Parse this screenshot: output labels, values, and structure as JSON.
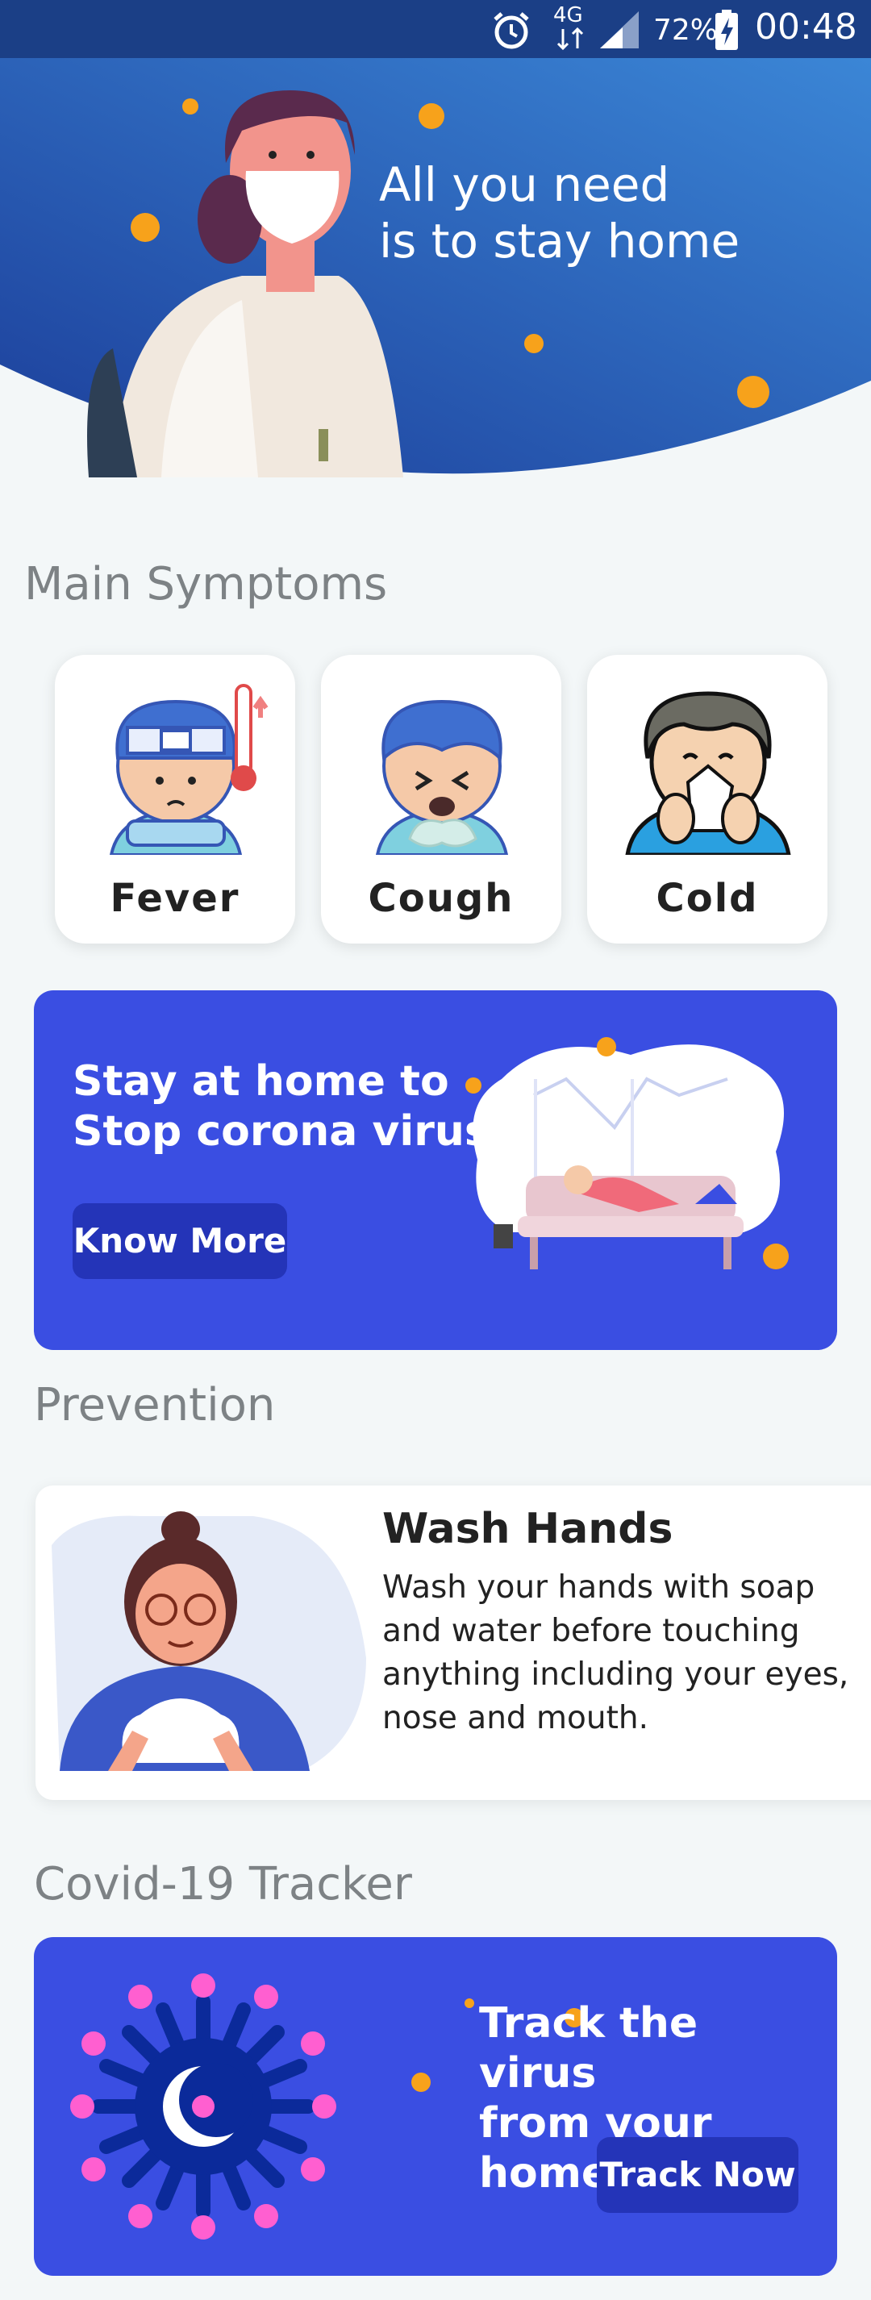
{
  "status_bar": {
    "network": "4G",
    "battery": "72%",
    "time": "00:48",
    "icons": [
      "alarm-icon",
      "network-icon",
      "signal-icon",
      "battery-icon"
    ]
  },
  "header": {
    "line1": "All you need",
    "line2": "is to stay home"
  },
  "symptoms": {
    "title": "Main Symptoms",
    "items": [
      {
        "label": "Fever",
        "icon": "fever-person-icon"
      },
      {
        "label": "Cough",
        "icon": "cough-person-icon"
      },
      {
        "label": "Cold",
        "icon": "cold-person-icon"
      }
    ]
  },
  "stay_home_banner": {
    "line1": "Stay at home to",
    "line2": "Stop corona virus",
    "button": "Know More"
  },
  "prevention": {
    "title": "Prevention",
    "card_title": "Wash Hands",
    "card_desc": "Wash your hands with soap and water before touching anything including your eyes, nose and mouth."
  },
  "tracker": {
    "title": "Covid-19 Tracker",
    "line1": "Track the virus",
    "line2": "from your home",
    "button": "Track Now"
  },
  "colors": {
    "accent": "#3a4ee2",
    "button_dark": "#2434b8",
    "status_bar": "#1b3f86",
    "header_blue": "#2a5bd0",
    "virus_orange": "#f7a21b",
    "virus_pink": "#ff5fd0"
  }
}
